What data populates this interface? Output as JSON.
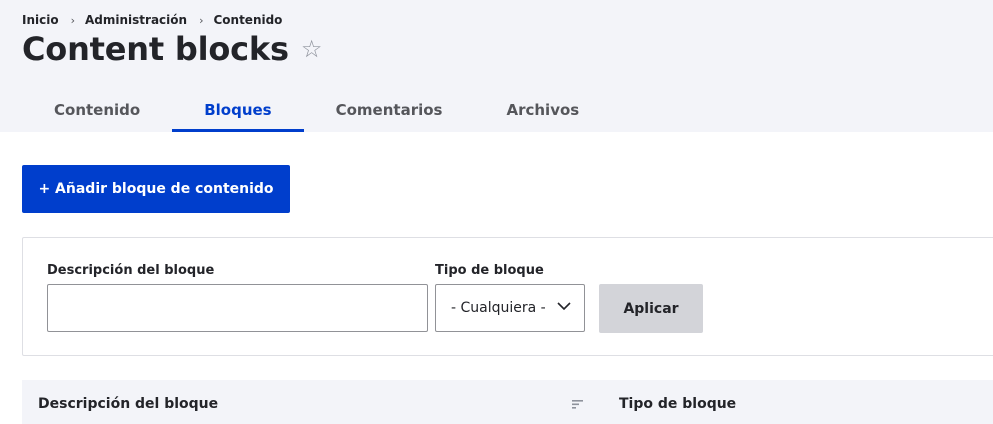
{
  "breadcrumb": {
    "items": [
      "Inicio",
      "Administración",
      "Contenido"
    ],
    "separator": "›"
  },
  "page": {
    "title": "Content blocks",
    "favorite_icon": "star-outline-icon"
  },
  "tabs": [
    {
      "label": "Contenido",
      "active": false
    },
    {
      "label": "Bloques",
      "active": true
    },
    {
      "label": "Comentarios",
      "active": false
    },
    {
      "label": "Archivos",
      "active": false
    }
  ],
  "actions": {
    "add_block_label": "+ Añadir bloque de contenido"
  },
  "filters": {
    "description_label": "Descripción del bloque",
    "description_value": "",
    "type_label": "Tipo de bloque",
    "type_selected": "- Cualquiera -",
    "apply_label": "Aplicar"
  },
  "table": {
    "columns": [
      "Descripción del bloque",
      "Tipo de bloque"
    ]
  },
  "colors": {
    "accent": "#003ecc",
    "header_bg": "#f3f4f9",
    "button_secondary": "#d3d4d9",
    "text": "#232429"
  }
}
